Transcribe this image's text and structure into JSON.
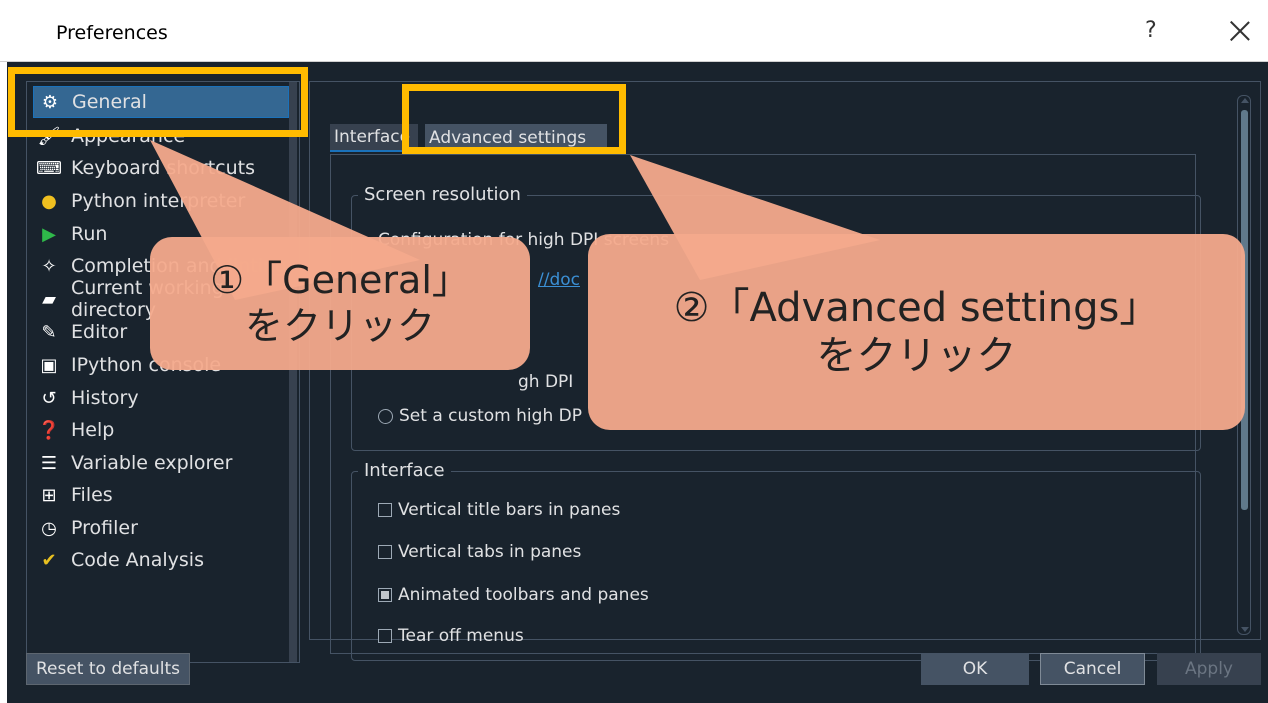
{
  "window": {
    "title": "Preferences",
    "help_glyph": "?",
    "close_icon": "close-icon"
  },
  "sidebar": {
    "items": [
      {
        "label": "General",
        "icon": "gears-icon",
        "selected": true
      },
      {
        "label": "Appearance",
        "icon": "brush-icon"
      },
      {
        "label": "Keyboard shortcuts",
        "icon": "keyboard-icon"
      },
      {
        "label": "Python interpreter",
        "icon": "python-icon"
      },
      {
        "label": "Run",
        "icon": "run-icon"
      },
      {
        "label": "Completion and linting",
        "icon": "completion-icon"
      },
      {
        "label": "Current working directory",
        "icon": "folder-icon"
      },
      {
        "label": "Editor",
        "icon": "edit-icon"
      },
      {
        "label": "IPython console",
        "icon": "console-icon"
      },
      {
        "label": "History",
        "icon": "history-icon"
      },
      {
        "label": "Help",
        "icon": "help-icon"
      },
      {
        "label": "Variable explorer",
        "icon": "list-icon"
      },
      {
        "label": "Files",
        "icon": "files-icon"
      },
      {
        "label": "Profiler",
        "icon": "clock-icon"
      },
      {
        "label": "Code Analysis",
        "icon": "code-analysis-icon"
      }
    ]
  },
  "tabs": {
    "interface": "Interface",
    "advanced": "Advanced settings"
  },
  "screen_resolution": {
    "title": "Screen resolution",
    "description": "Configuration for high DPI screens",
    "link_text": "//doc",
    "option_normal": "gh DPI",
    "option_custom": "Set a custom high DP"
  },
  "interface_group": {
    "title": "Interface",
    "options": [
      {
        "label": "Vertical title bars in panes",
        "checked": false
      },
      {
        "label": "Vertical tabs in panes",
        "checked": false
      },
      {
        "label": "Animated toolbars and panes",
        "checked": true
      },
      {
        "label": "Tear off menus",
        "checked": false
      }
    ]
  },
  "buttons": {
    "reset": "Reset to defaults",
    "ok": "OK",
    "cancel": "Cancel",
    "apply": "Apply"
  },
  "annotations": {
    "callout1": {
      "line1": "①「General」",
      "line2": "をクリック"
    },
    "callout2": {
      "line1": "②「Advanced settings」",
      "line2": "をクリック"
    },
    "highlight_color": "#ffbb00",
    "bubble_color": "#f4aa8c"
  }
}
